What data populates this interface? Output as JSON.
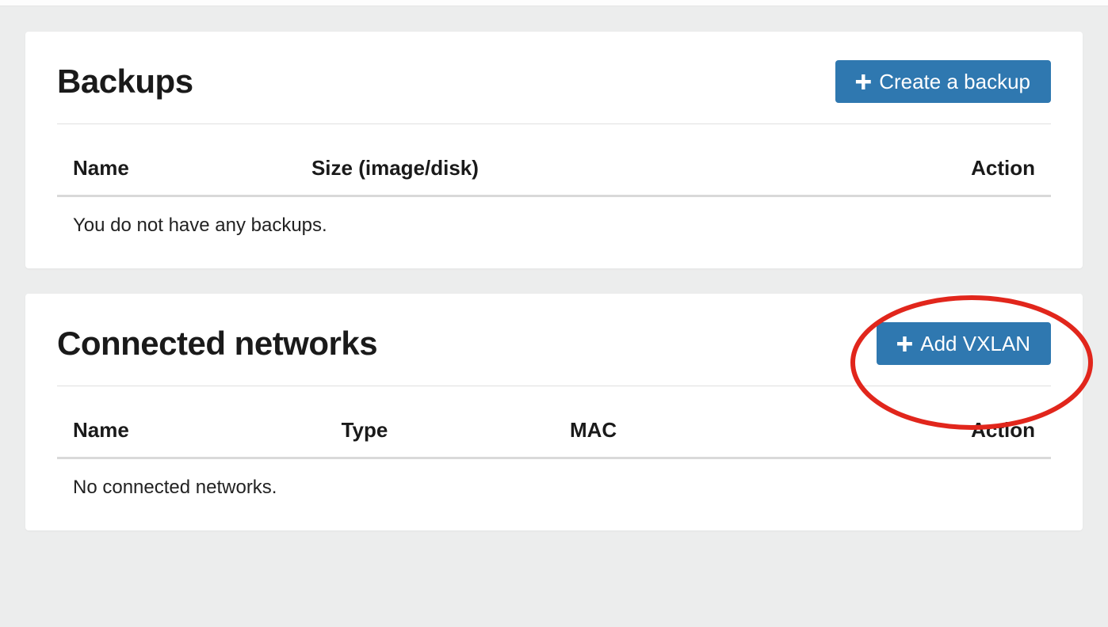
{
  "backups": {
    "title": "Backups",
    "create_label": "Create a backup",
    "columns": {
      "name": "Name",
      "size": "Size (image/disk)",
      "action": "Action"
    },
    "empty_message": "You do not have any backups."
  },
  "networks": {
    "title": "Connected networks",
    "add_label": "Add VXLAN",
    "columns": {
      "name": "Name",
      "type": "Type",
      "mac": "MAC",
      "action": "Action"
    },
    "empty_message": "No connected networks."
  }
}
